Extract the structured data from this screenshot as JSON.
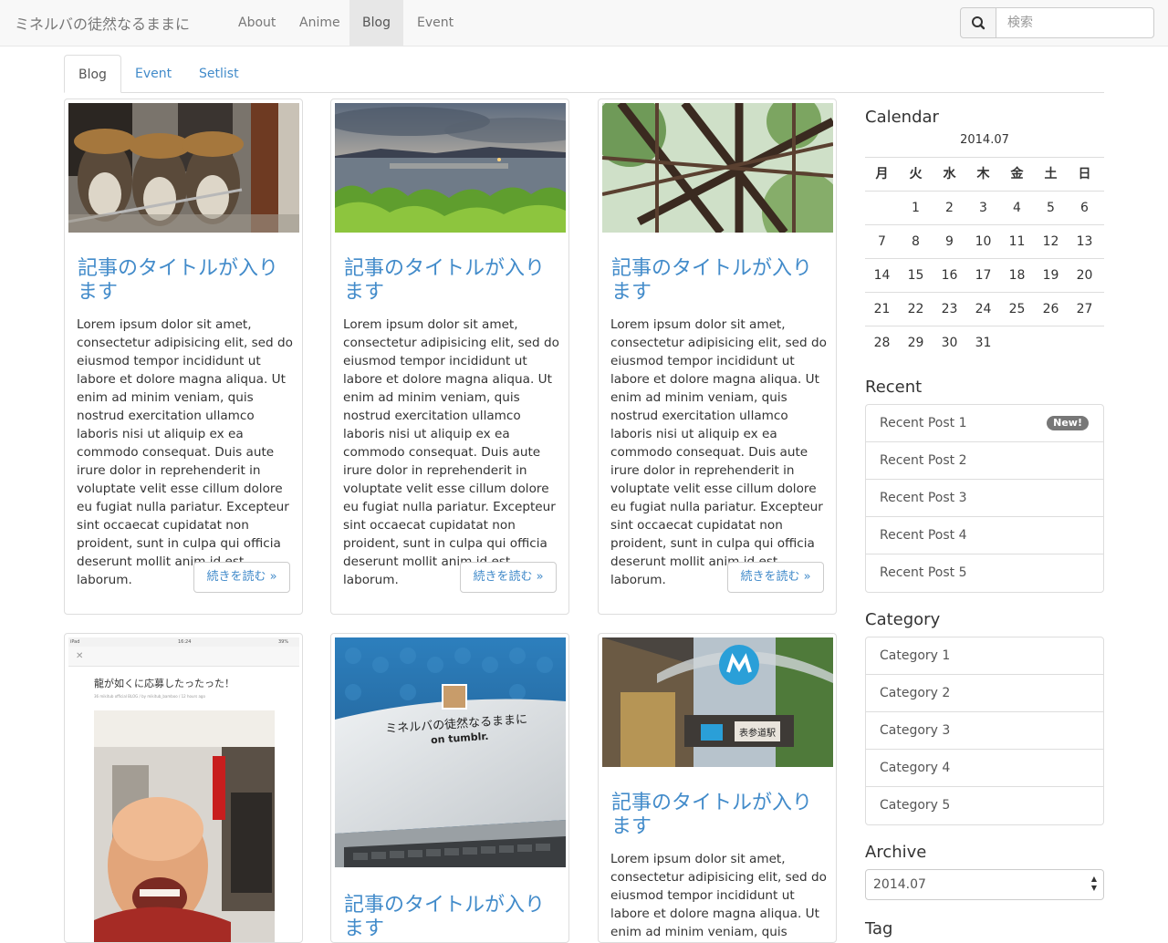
{
  "navbar": {
    "brand": "ミネルバの徒然なるままに",
    "items": [
      {
        "label": "About"
      },
      {
        "label": "Anime"
      },
      {
        "label": "Blog"
      },
      {
        "label": "Event"
      }
    ],
    "active": "Blog",
    "search": {
      "placeholder": "検索",
      "icon": "search-icon"
    }
  },
  "tabs": [
    {
      "label": "Blog"
    },
    {
      "label": "Event"
    },
    {
      "label": "Setlist"
    }
  ],
  "posts": [
    {
      "image": "tanuki-statues-photo",
      "title": "記事のタイトルが入ります",
      "body": "Lorem ipsum dolor sit amet, consectetur adipisicing elit, sed do eiusmod tempor incididunt ut labore et dolore magna aliqua. Ut enim ad minim veniam, quis nostrud exercitation ullamco laboris nisi ut aliquip ex ea commodo consequat. Duis aute irure dolor in reprehenderit in voluptate velit esse cillum dolore eu fugiat nulla pariatur. Excepteur sint occaecat cupidatat non proident, sunt in culpa qui officia deserunt mollit anim id est laborum.",
      "more": "続きを読む »"
    },
    {
      "image": "lake-sunset-photo",
      "title": "記事のタイトルが入ります",
      "body": "Lorem ipsum dolor sit amet, consectetur adipisicing elit, sed do eiusmod tempor incididunt ut labore et dolore magna aliqua. Ut enim ad minim veniam, quis nostrud exercitation ullamco laboris nisi ut aliquip ex ea commodo consequat. Duis aute irure dolor in reprehenderit in voluptate velit esse cillum dolore eu fugiat nulla pariatur. Excepteur sint occaecat cupidatat non proident, sunt in culpa qui officia deserunt mollit anim id est laborum.",
      "more": "続きを読む »"
    },
    {
      "image": "wooden-pergola-photo",
      "title": "記事のタイトルが入ります",
      "body": "Lorem ipsum dolor sit amet, consectetur adipisicing elit, sed do eiusmod tempor incididunt ut labore et dolore magna aliqua. Ut enim ad minim veniam, quis nostrud exercitation ullamco laboris nisi ut aliquip ex ea commodo consequat. Duis aute irure dolor in reprehenderit in voluptate velit esse cillum dolore eu fugiat nulla pariatur. Excepteur sint occaecat cupidatat non proident, sunt in culpa qui officia deserunt mollit anim id est laborum.",
      "more": "続きを読む »"
    },
    {
      "image": "tablet-screenshot-photo",
      "caption": "龍が如くに応募したったった！",
      "byline": "36 mikitub official BLOG / by mikitub_bamboo / 12 hours ago",
      "status_left": "iPad",
      "status_time": "16:24",
      "status_battery": "39%"
    },
    {
      "image": "laptop-tumblr-photo",
      "title": "記事のタイトルが入ります",
      "screen_line1": "ミネルバの徒然なるままに",
      "screen_line2": "on tumblr."
    },
    {
      "image": "omotesando-station-photo",
      "title": "記事のタイトルが入ります",
      "station_sign": "表参道駅",
      "body": "Lorem ipsum dolor sit amet, consectetur adipisicing elit, sed do eiusmod tempor incididunt ut labore et dolore magna aliqua. Ut enim ad minim veniam, quis nostrud"
    }
  ],
  "calendar": {
    "heading": "Calendar",
    "month": "2014.07",
    "weekdays": [
      "月",
      "火",
      "水",
      "木",
      "金",
      "土",
      "日"
    ],
    "weeks": [
      [
        "",
        "1",
        "2",
        "3",
        "4",
        "5",
        "6"
      ],
      [
        "7",
        "8",
        "9",
        "10",
        "11",
        "12",
        "13"
      ],
      [
        "14",
        "15",
        "16",
        "17",
        "18",
        "19",
        "20"
      ],
      [
        "21",
        "22",
        "23",
        "24",
        "25",
        "26",
        "27"
      ],
      [
        "28",
        "29",
        "30",
        "31",
        "",
        "",
        ""
      ]
    ]
  },
  "recent": {
    "heading": "Recent",
    "items": [
      {
        "label": "Recent Post 1",
        "badge": "New!"
      },
      {
        "label": "Recent Post 2"
      },
      {
        "label": "Recent Post 3"
      },
      {
        "label": "Recent Post 4"
      },
      {
        "label": "Recent Post 5"
      }
    ]
  },
  "category": {
    "heading": "Category",
    "items": [
      {
        "label": "Category 1"
      },
      {
        "label": "Category 2"
      },
      {
        "label": "Category 3"
      },
      {
        "label": "Category 4"
      },
      {
        "label": "Category 5"
      }
    ]
  },
  "archive": {
    "heading": "Archive",
    "selected": "2014.07"
  },
  "tag": {
    "heading": "Tag"
  },
  "colors": {
    "link": "#428bca",
    "navbar_bg": "#f8f8f8",
    "badge": "#777777"
  }
}
